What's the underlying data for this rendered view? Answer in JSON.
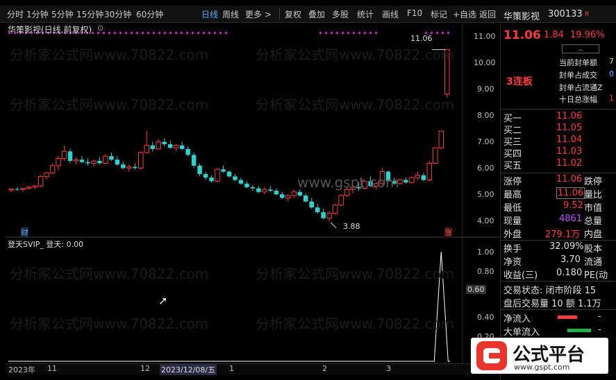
{
  "toolbar": {
    "timeframes": [
      "分时",
      "1分钟",
      "5分钟",
      "15分钟",
      "30分钟",
      "60分钟",
      "日线",
      "周线",
      "更多 >"
    ],
    "active": "日线",
    "actions": [
      "复权",
      "叠加",
      "多股",
      "统计",
      "画线",
      "F10",
      "标记",
      "+自选",
      "返回"
    ]
  },
  "chart": {
    "title": "华策影视(日线,前复权)",
    "price_ticks": [
      "11.00",
      "10.00",
      "9.00",
      "8.00",
      "7.00",
      "6.00",
      "5.00",
      "4.00"
    ],
    "high_label": "11.06",
    "low_label": "3.88",
    "marker_left": "财",
    "marker_right": "涨",
    "indicator_title": "登天SVIP_ 登天: 0.00",
    "indicator_ticks": [
      "1.00",
      "0.80",
      "0.60",
      "0.40",
      "0.20"
    ],
    "indicator_cursor_value": "0.60",
    "date_labels": [
      "2023年",
      "11",
      "12",
      "2023/12/08/五",
      "1",
      "2",
      "3"
    ],
    "watermark_domain": "分析家公式网www.70822.com",
    "watermark_center": "www.gspt.com"
  },
  "chart_data": {
    "type": "candlestick",
    "title": "华策影视(日线,前复权)",
    "ylim": [
      3.7,
      11.6
    ],
    "candles": [
      [
        5.18,
        5.25,
        5.1,
        5.22
      ],
      [
        5.22,
        5.3,
        5.15,
        5.2
      ],
      [
        5.2,
        5.28,
        5.12,
        5.25
      ],
      [
        5.25,
        5.35,
        5.2,
        5.3
      ],
      [
        5.3,
        5.4,
        5.22,
        5.35
      ],
      [
        5.35,
        5.8,
        5.3,
        5.75
      ],
      [
        5.75,
        5.95,
        5.6,
        5.9
      ],
      [
        5.9,
        6.3,
        5.85,
        6.2
      ],
      [
        6.2,
        6.6,
        6.0,
        6.5
      ],
      [
        6.5,
        7.05,
        6.4,
        6.8
      ],
      [
        6.8,
        6.9,
        6.3,
        6.4
      ],
      [
        6.4,
        6.55,
        6.25,
        6.45
      ],
      [
        6.45,
        6.6,
        6.3,
        6.35
      ],
      [
        6.35,
        6.5,
        6.2,
        6.3
      ],
      [
        6.3,
        6.45,
        6.15,
        6.4
      ],
      [
        6.4,
        6.55,
        6.25,
        6.3
      ],
      [
        6.3,
        6.7,
        6.25,
        6.6
      ],
      [
        6.6,
        6.75,
        6.4,
        6.45
      ],
      [
        6.45,
        6.6,
        6.2,
        6.25
      ],
      [
        6.25,
        6.35,
        6.05,
        6.1
      ],
      [
        6.1,
        6.25,
        5.95,
        6.15
      ],
      [
        6.15,
        6.3,
        6.05,
        6.1
      ],
      [
        6.1,
        6.8,
        6.05,
        6.75
      ],
      [
        6.75,
        7.65,
        6.7,
        7.05
      ],
      [
        7.05,
        7.2,
        6.8,
        6.9
      ],
      [
        6.9,
        7.3,
        6.85,
        7.2
      ],
      [
        7.2,
        7.35,
        7.0,
        7.1
      ],
      [
        7.1,
        7.25,
        6.9,
        6.95
      ],
      [
        6.95,
        7.1,
        6.8,
        7.05
      ],
      [
        7.05,
        7.2,
        6.85,
        6.9
      ],
      [
        6.9,
        7.0,
        6.6,
        6.65
      ],
      [
        6.65,
        6.75,
        6.1,
        6.2
      ],
      [
        6.2,
        6.3,
        5.75,
        5.85
      ],
      [
        5.85,
        5.95,
        5.6,
        5.7
      ],
      [
        5.7,
        5.8,
        5.5,
        5.55
      ],
      [
        5.55,
        6.1,
        5.5,
        6.05
      ],
      [
        6.05,
        6.2,
        5.9,
        5.95
      ],
      [
        5.95,
        6.0,
        5.7,
        5.75
      ],
      [
        5.75,
        5.85,
        5.55,
        5.6
      ],
      [
        5.6,
        5.7,
        5.4,
        5.45
      ],
      [
        5.45,
        5.55,
        5.25,
        5.3
      ],
      [
        5.3,
        5.4,
        5.15,
        5.25
      ],
      [
        5.25,
        5.35,
        5.05,
        5.1
      ],
      [
        5.1,
        5.3,
        5.0,
        5.2
      ],
      [
        5.2,
        5.35,
        5.1,
        5.15
      ],
      [
        5.15,
        5.25,
        4.95,
        5.0
      ],
      [
        5.0,
        5.1,
        4.8,
        4.85
      ],
      [
        4.85,
        5.0,
        4.7,
        4.95
      ],
      [
        4.95,
        5.2,
        4.85,
        5.1
      ],
      [
        5.1,
        5.2,
        4.9,
        4.95
      ],
      [
        4.95,
        5.05,
        4.65,
        4.7
      ],
      [
        4.7,
        4.85,
        4.4,
        4.45
      ],
      [
        4.45,
        4.6,
        4.2,
        4.25
      ],
      [
        4.25,
        4.4,
        3.95,
        4.0
      ],
      [
        4.0,
        4.3,
        3.88,
        4.2
      ],
      [
        4.2,
        4.6,
        4.15,
        4.55
      ],
      [
        4.55,
        5.0,
        4.5,
        4.95
      ],
      [
        4.95,
        5.3,
        4.9,
        5.2
      ],
      [
        5.2,
        5.4,
        5.05,
        5.3
      ],
      [
        5.3,
        5.5,
        5.15,
        5.25
      ],
      [
        5.25,
        5.6,
        5.2,
        5.55
      ],
      [
        5.55,
        5.75,
        5.3,
        5.35
      ],
      [
        5.35,
        5.5,
        5.2,
        5.45
      ],
      [
        5.45,
        6.1,
        5.4,
        5.95
      ],
      [
        5.95,
        6.0,
        5.5,
        5.55
      ],
      [
        5.55,
        5.7,
        5.4,
        5.45
      ],
      [
        5.45,
        5.65,
        5.4,
        5.6
      ],
      [
        5.6,
        5.7,
        5.45,
        5.5
      ],
      [
        5.5,
        5.75,
        5.45,
        5.7
      ],
      [
        5.7,
        5.95,
        5.6,
        5.8
      ],
      [
        5.8,
        5.9,
        5.55,
        5.6
      ],
      [
        5.6,
        6.4,
        5.55,
        6.3
      ],
      [
        6.3,
        6.95,
        6.25,
        6.95
      ],
      [
        6.95,
        7.65,
        6.9,
        7.65
      ],
      [
        9.2,
        11.06,
        9.05,
        11.06
      ]
    ],
    "indicator": {
      "name": "登天",
      "value": 0.0,
      "ylim": [
        0,
        1.0
      ],
      "spike_index": 73,
      "spike_value": 1.0
    }
  },
  "side": {
    "name": "华策影视",
    "code": "300133",
    "badge": "R",
    "price": "11.06",
    "change": "1.84",
    "pct": "19.96%",
    "limit_tag": "3连板",
    "seal_labels": [
      "当前封单额",
      "封单占成交",
      "封单占流通Z",
      "十日总涨幅"
    ],
    "seal_values": [
      "7",
      "0",
      "",
      "1"
    ],
    "bids": [
      {
        "label": "买一",
        "price": "11.06"
      },
      {
        "label": "买二",
        "price": "11.05"
      },
      {
        "label": "买三",
        "price": "11.04"
      },
      {
        "label": "买四",
        "price": "11.03"
      },
      {
        "label": "买五",
        "price": "11.02"
      }
    ],
    "stats": [
      {
        "label": "涨停",
        "value": "11.06",
        "label2": "跌停"
      },
      {
        "label": "最高",
        "value": "11.06",
        "label2": "量比"
      },
      {
        "label": "最低",
        "value": "9.52",
        "label2": "市值"
      },
      {
        "label": "现量",
        "value": "4861",
        "label2": "总量"
      },
      {
        "label": "外盘",
        "value": "279.1万",
        "label2": "内盘"
      }
    ],
    "fund": [
      {
        "label": "换手",
        "value": "32.09%",
        "label2": "股本"
      },
      {
        "label": "净资",
        "value": "3.70",
        "label2": "流通"
      },
      {
        "label": "收益(三)",
        "value": "0.180",
        "label2": "PE(动"
      }
    ],
    "trade_state": "交易状态: 闭市阶段 15",
    "after_hours": "盘后交易量 10 额 1.1万",
    "flows": [
      {
        "label": "净流入",
        "value": "-"
      },
      {
        "label": "大单流入",
        "value": "-"
      }
    ]
  },
  "logo": {
    "brand": "公式平台",
    "url": "www.gspt.com"
  }
}
